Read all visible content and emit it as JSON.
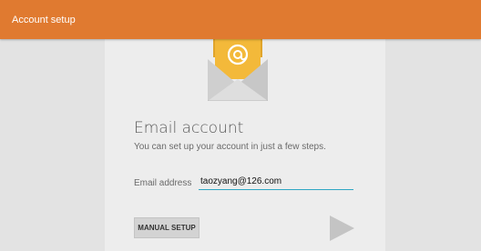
{
  "action_bar": {
    "title": "Account setup",
    "color": "#e07a30"
  },
  "icons": {
    "envelope": "email-envelope-icon",
    "next": "play-arrow-icon"
  },
  "main": {
    "heading": "Email account",
    "subtitle": "You can set up your account in just a few steps.",
    "email_label": "Email address",
    "email_value": "taozyang@126.com",
    "manual_setup_label": "MANUAL SETUP"
  },
  "colors": {
    "accent": "#2fa6c4",
    "envelope_yellow": "#f3b93a",
    "envelope_body": "#dcdcdc"
  }
}
